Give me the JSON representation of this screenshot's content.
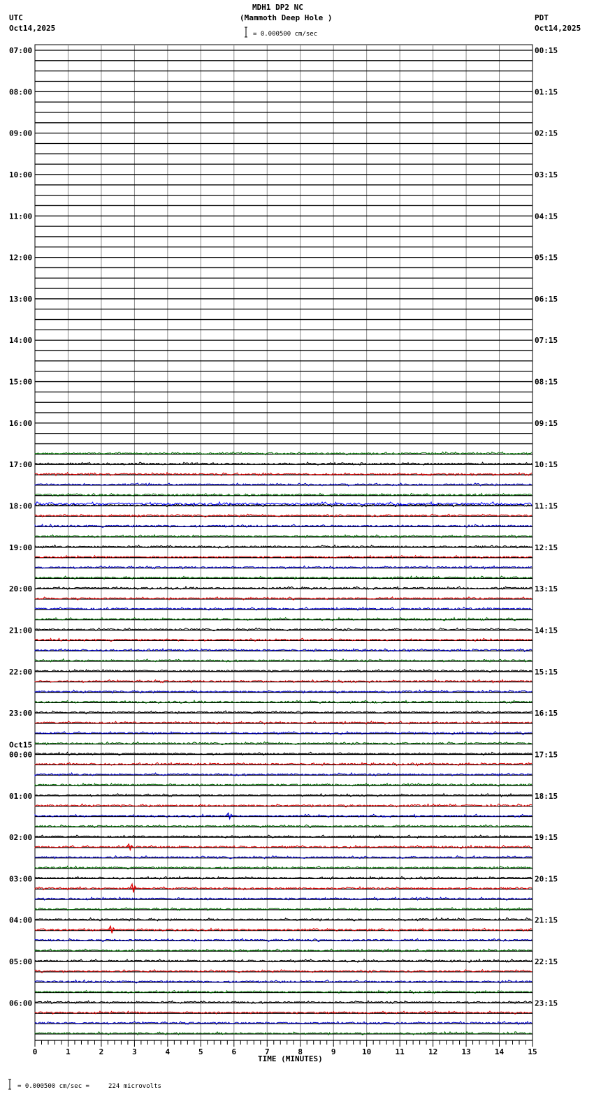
{
  "header": {
    "title": "MDH1 DP2 NC",
    "subtitle": "(Mammoth Deep Hole )",
    "left_tz": "UTC",
    "left_date": "Oct14,2025",
    "right_tz": "PDT",
    "right_date": "Oct14,2025",
    "scale_text": "= 0.000500 cm/sec"
  },
  "footer": {
    "scale_text": "= 0.000500 cm/sec =     224 microvolts"
  },
  "chart_data": {
    "type": "line",
    "title": "MDH1 DP2 NC (Mammoth Deep Hole )",
    "xlabel": "TIME (MINUTES)",
    "xlim": [
      0,
      15
    ],
    "x_ticks": [
      "0",
      "1",
      "2",
      "3",
      "4",
      "5",
      "6",
      "7",
      "8",
      "9",
      "10",
      "11",
      "12",
      "13",
      "14",
      "15"
    ],
    "rows_total": 96,
    "rows_per_hour": 4,
    "first_data_row": 39,
    "trace_colors": [
      "#000000",
      "#e00000",
      "#0000d0",
      "#007000"
    ],
    "left_labels": [
      "07:00",
      "08:00",
      "09:00",
      "10:00",
      "11:00",
      "12:00",
      "13:00",
      "14:00",
      "15:00",
      "16:00",
      "17:00",
      "18:00",
      "19:00",
      "20:00",
      "21:00",
      "22:00",
      "23:00",
      "00:00",
      "01:00",
      "02:00",
      "03:00",
      "04:00",
      "05:00",
      "06:00"
    ],
    "date_change_label": "Oct15",
    "right_labels": [
      "00:15",
      "01:15",
      "02:15",
      "03:15",
      "04:15",
      "05:15",
      "06:15",
      "07:15",
      "08:15",
      "09:15",
      "10:15",
      "11:15",
      "12:15",
      "13:15",
      "14:15",
      "15:15",
      "16:15",
      "17:15",
      "18:15",
      "19:15",
      "20:15",
      "21:15",
      "22:15",
      "23:15"
    ],
    "events": [
      {
        "row": 74,
        "minute": 5.85,
        "amplitude": 4
      },
      {
        "row": 77,
        "minute": 2.85,
        "amplitude": 4
      },
      {
        "row": 81,
        "minute": 2.95,
        "amplitude": 6
      },
      {
        "row": 85,
        "minute": 2.3,
        "amplitude": 5
      }
    ],
    "extra_noisy_trace": {
      "after_row": 43,
      "color": "#0000ff"
    }
  }
}
